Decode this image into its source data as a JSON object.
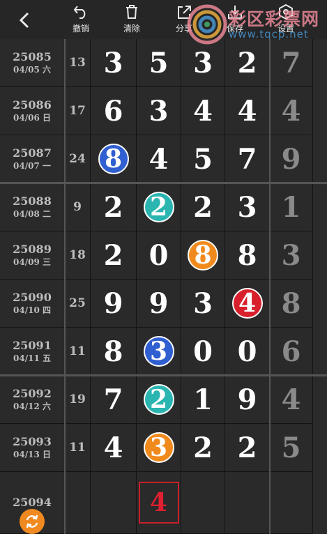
{
  "toolbar": {
    "undo_label": "撤销",
    "clear_label": "清除",
    "share_label": "分享",
    "save_label": "保存",
    "settings_label": "设置"
  },
  "watermark": {
    "text": "彩区彩票网",
    "url": "www.tqcp.net"
  },
  "rows": [
    {
      "issue": "25085",
      "date": "04/05 六",
      "sum": "13",
      "digits": [
        "3",
        "5",
        "3",
        "2"
      ],
      "last": "7",
      "balls": [
        null,
        null,
        null,
        null
      ]
    },
    {
      "issue": "25086",
      "date": "04/06 日",
      "sum": "17",
      "digits": [
        "6",
        "3",
        "4",
        "4"
      ],
      "last": "4",
      "balls": [
        null,
        null,
        null,
        null
      ]
    },
    {
      "issue": "25087",
      "date": "04/07 一",
      "sum": "24",
      "digits": [
        "8",
        "4",
        "5",
        "7"
      ],
      "last": "9",
      "balls": [
        "blue",
        null,
        null,
        null
      ]
    },
    {
      "issue": "25088",
      "date": "04/08 二",
      "sum": "9",
      "digits": [
        "2",
        "2",
        "2",
        "3"
      ],
      "last": "1",
      "balls": [
        null,
        "teal",
        null,
        null
      ]
    },
    {
      "issue": "25089",
      "date": "04/09 三",
      "sum": "18",
      "digits": [
        "2",
        "0",
        "8",
        "8"
      ],
      "last": "3",
      "balls": [
        null,
        null,
        "orange",
        null
      ]
    },
    {
      "issue": "25090",
      "date": "04/10 四",
      "sum": "25",
      "digits": [
        "9",
        "9",
        "3",
        "4"
      ],
      "last": "8",
      "balls": [
        null,
        null,
        null,
        "red"
      ]
    },
    {
      "issue": "25091",
      "date": "04/11 五",
      "sum": "11",
      "digits": [
        "8",
        "3",
        "0",
        "0"
      ],
      "last": "6",
      "balls": [
        null,
        "blue",
        null,
        null
      ]
    },
    {
      "issue": "25092",
      "date": "04/12 六",
      "sum": "19",
      "digits": [
        "7",
        "2",
        "1",
        "9"
      ],
      "last": "4",
      "balls": [
        null,
        "teal",
        null,
        null
      ]
    },
    {
      "issue": "25093",
      "date": "04/13 日",
      "sum": "11",
      "digits": [
        "4",
        "3",
        "2",
        "2"
      ],
      "last": "5",
      "balls": [
        null,
        "orange",
        null,
        null
      ]
    }
  ],
  "pending": {
    "issue": "25094",
    "prediction": "4",
    "prediction_column": 1
  },
  "colors": {
    "blue": "#2f5fd0",
    "teal": "#2bb5b0",
    "orange": "#f08a1c",
    "red": "#d8202c",
    "prediction": "#e02030"
  },
  "icons": [
    "back-arrow-icon",
    "undo-icon",
    "trash-icon",
    "share-icon",
    "download-icon",
    "settings-icon",
    "refresh-icon"
  ]
}
